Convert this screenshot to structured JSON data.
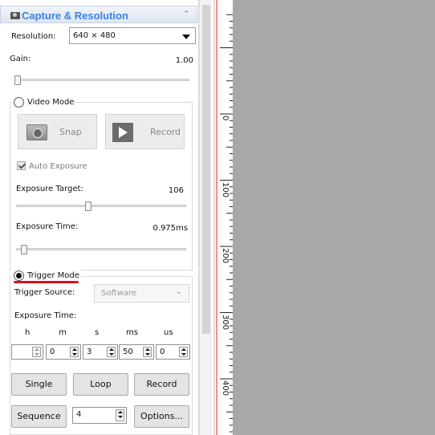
{
  "panel": {
    "title": "Capture & Resolution",
    "resolution_label": "Resolution:",
    "resolution_value": "640 × 480",
    "gain_label": "Gain:",
    "gain_value": "1.00",
    "gain_level": 0.0,
    "video_mode": {
      "label": "Video Mode",
      "snap_label": "Snap",
      "record_label": "Record",
      "auto_exposure_label": "Auto Exposure",
      "auto_exposure_checked": true,
      "exposure_target_label": "Exposure Target:",
      "exposure_target_value": "106",
      "exposure_target_level": 0.42,
      "exposure_time_label": "Exposure Time:",
      "exposure_time_value": "0.975ms",
      "exposure_time_level": 0.03
    },
    "trigger_mode": {
      "label": "Trigger Mode",
      "selected": true,
      "source_label": "Trigger Source:",
      "source_value": "Software",
      "exposure_time_label": "Exposure Time:",
      "units": [
        "h",
        "m",
        "s",
        "ms",
        "us"
      ],
      "values": [
        "",
        "0",
        "3",
        "50",
        "0"
      ],
      "single_label": "Single",
      "loop_label": "Loop",
      "record_label": "Record",
      "sequence_label": "Sequence",
      "sequence_count": "4",
      "options_label": "Options..."
    }
  },
  "ruler": {
    "marks": [
      "0",
      "100",
      "200",
      "300",
      "400"
    ]
  },
  "colors": {
    "title": "#3d82e3",
    "highlight_underline": "#d8101f",
    "canvas": "#a8a8a8",
    "ruler_red_line": "#f06a6a"
  }
}
